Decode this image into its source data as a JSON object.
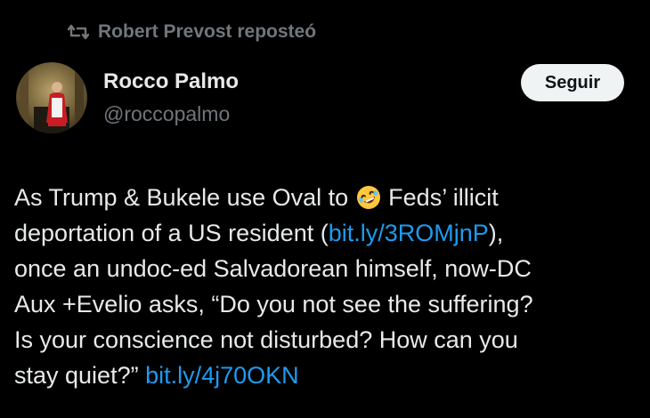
{
  "repost": {
    "label": "Robert Prevost reposteó",
    "icon": "repost-icon"
  },
  "author": {
    "display_name": "Rocco Palmo",
    "handle": "@roccopalmo",
    "avatar_icon": "avatar-photo"
  },
  "follow_button": {
    "label": "Seguir"
  },
  "tweet": {
    "line1_before": "As Trump & Bukele use Oval to ",
    "emoji": "rolling-on-floor-laughing-emoji",
    "line1_after": " Feds’ illicit",
    "line2_before": "deportation of a US resident (",
    "link1": "bit.ly/3ROMjnP",
    "line2_after": "),",
    "line3": "once an undoc-ed Salvadorean himself, now-DC",
    "line4": "Aux +Evelio asks, “Do you not see the suffering?",
    "line5": "Is your conscience not disturbed? How can you",
    "line6_before": "stay quiet?” ",
    "link2": "bit.ly/4j70OKN"
  },
  "colors": {
    "background": "#000000",
    "text": "#e7e9ea",
    "muted": "#71767b",
    "link": "#1d9bf0",
    "button_bg": "#eff3f4"
  }
}
